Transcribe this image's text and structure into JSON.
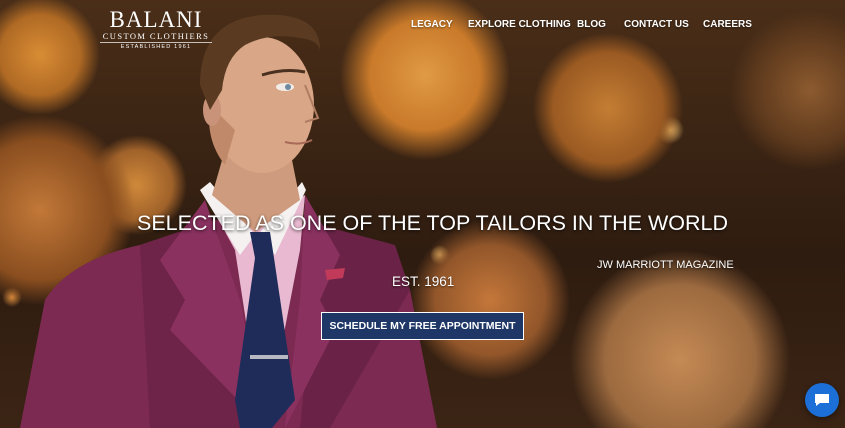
{
  "brand": {
    "name": "BALANI",
    "subtitle": "CUSTOM CLOTHIERS",
    "established": "ESTABLISHED 1961"
  },
  "nav": {
    "items": [
      {
        "label": "LEGACY"
      },
      {
        "label": "EXPLORE CLOTHING"
      },
      {
        "label": "BLOG"
      },
      {
        "label": "CONTACT US"
      },
      {
        "label": "CAREERS"
      }
    ]
  },
  "hero": {
    "headline": "SELECTED AS ONE OF THE TOP TAILORS IN THE WORLD",
    "source": "JW MARRIOTT MAGAZINE",
    "est": "EST. 1961",
    "cta_label": "SCHEDULE MY FREE APPOINTMENT"
  },
  "colors": {
    "cta_background": "#1e3766",
    "chat_button": "#1b6fd6",
    "jacket": "#7c2a52"
  },
  "icons": {
    "chat": "chat-bubble-icon"
  }
}
